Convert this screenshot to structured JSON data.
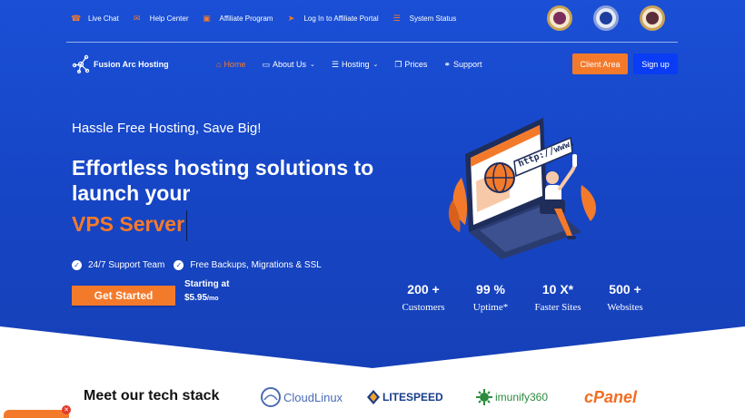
{
  "topbar": {
    "items": [
      {
        "label": "Live Chat",
        "icon": "phone-icon"
      },
      {
        "label": "Help Center",
        "icon": "envelope-icon"
      },
      {
        "label": "Affiliate Program",
        "icon": "monitor-icon"
      },
      {
        "label": "Log In to Affiliate Portal",
        "icon": "paper-plane-icon"
      },
      {
        "label": "System Status",
        "icon": "list-icon"
      }
    ]
  },
  "brand": {
    "name": "Fusion Arc Hosting"
  },
  "nav": {
    "items": [
      {
        "label": "Home",
        "active": true
      },
      {
        "label": "About Us",
        "dropdown": true
      },
      {
        "label": "Hosting",
        "dropdown": true
      },
      {
        "label": "Prices"
      },
      {
        "label": "Support"
      }
    ],
    "client_area": "Client Area",
    "sign_up": "Sign up"
  },
  "hero": {
    "tagline": "Hassle Free Hosting, Save Big!",
    "headline": "Effortless hosting solutions to launch your",
    "typed_word": "VPS Server",
    "features": [
      "24/7 Support Team",
      "Free Backups, Migrations & SSL"
    ],
    "cta": "Get Started",
    "price_label": "Starting at",
    "price_value": "$5.95",
    "price_unit": "/mo",
    "illustration_text": "http://www."
  },
  "stats": [
    {
      "value": "200 +",
      "label": "Customers"
    },
    {
      "value": "99 %",
      "label": "Uptime*"
    },
    {
      "value": "10 X*",
      "label": "Faster Sites"
    },
    {
      "value": "500 +",
      "label": "Websites"
    }
  ],
  "tech": {
    "title": "Meet our tech stack",
    "logos": {
      "cloudlinux": "CloudLinux",
      "litespeed": "LITESPEED",
      "imunify": "imunify360",
      "cpanel": "cPanel"
    }
  },
  "colors": {
    "primary": "#1a4fd6",
    "accent": "#f47a2b",
    "signup": "#0a3cf5"
  }
}
